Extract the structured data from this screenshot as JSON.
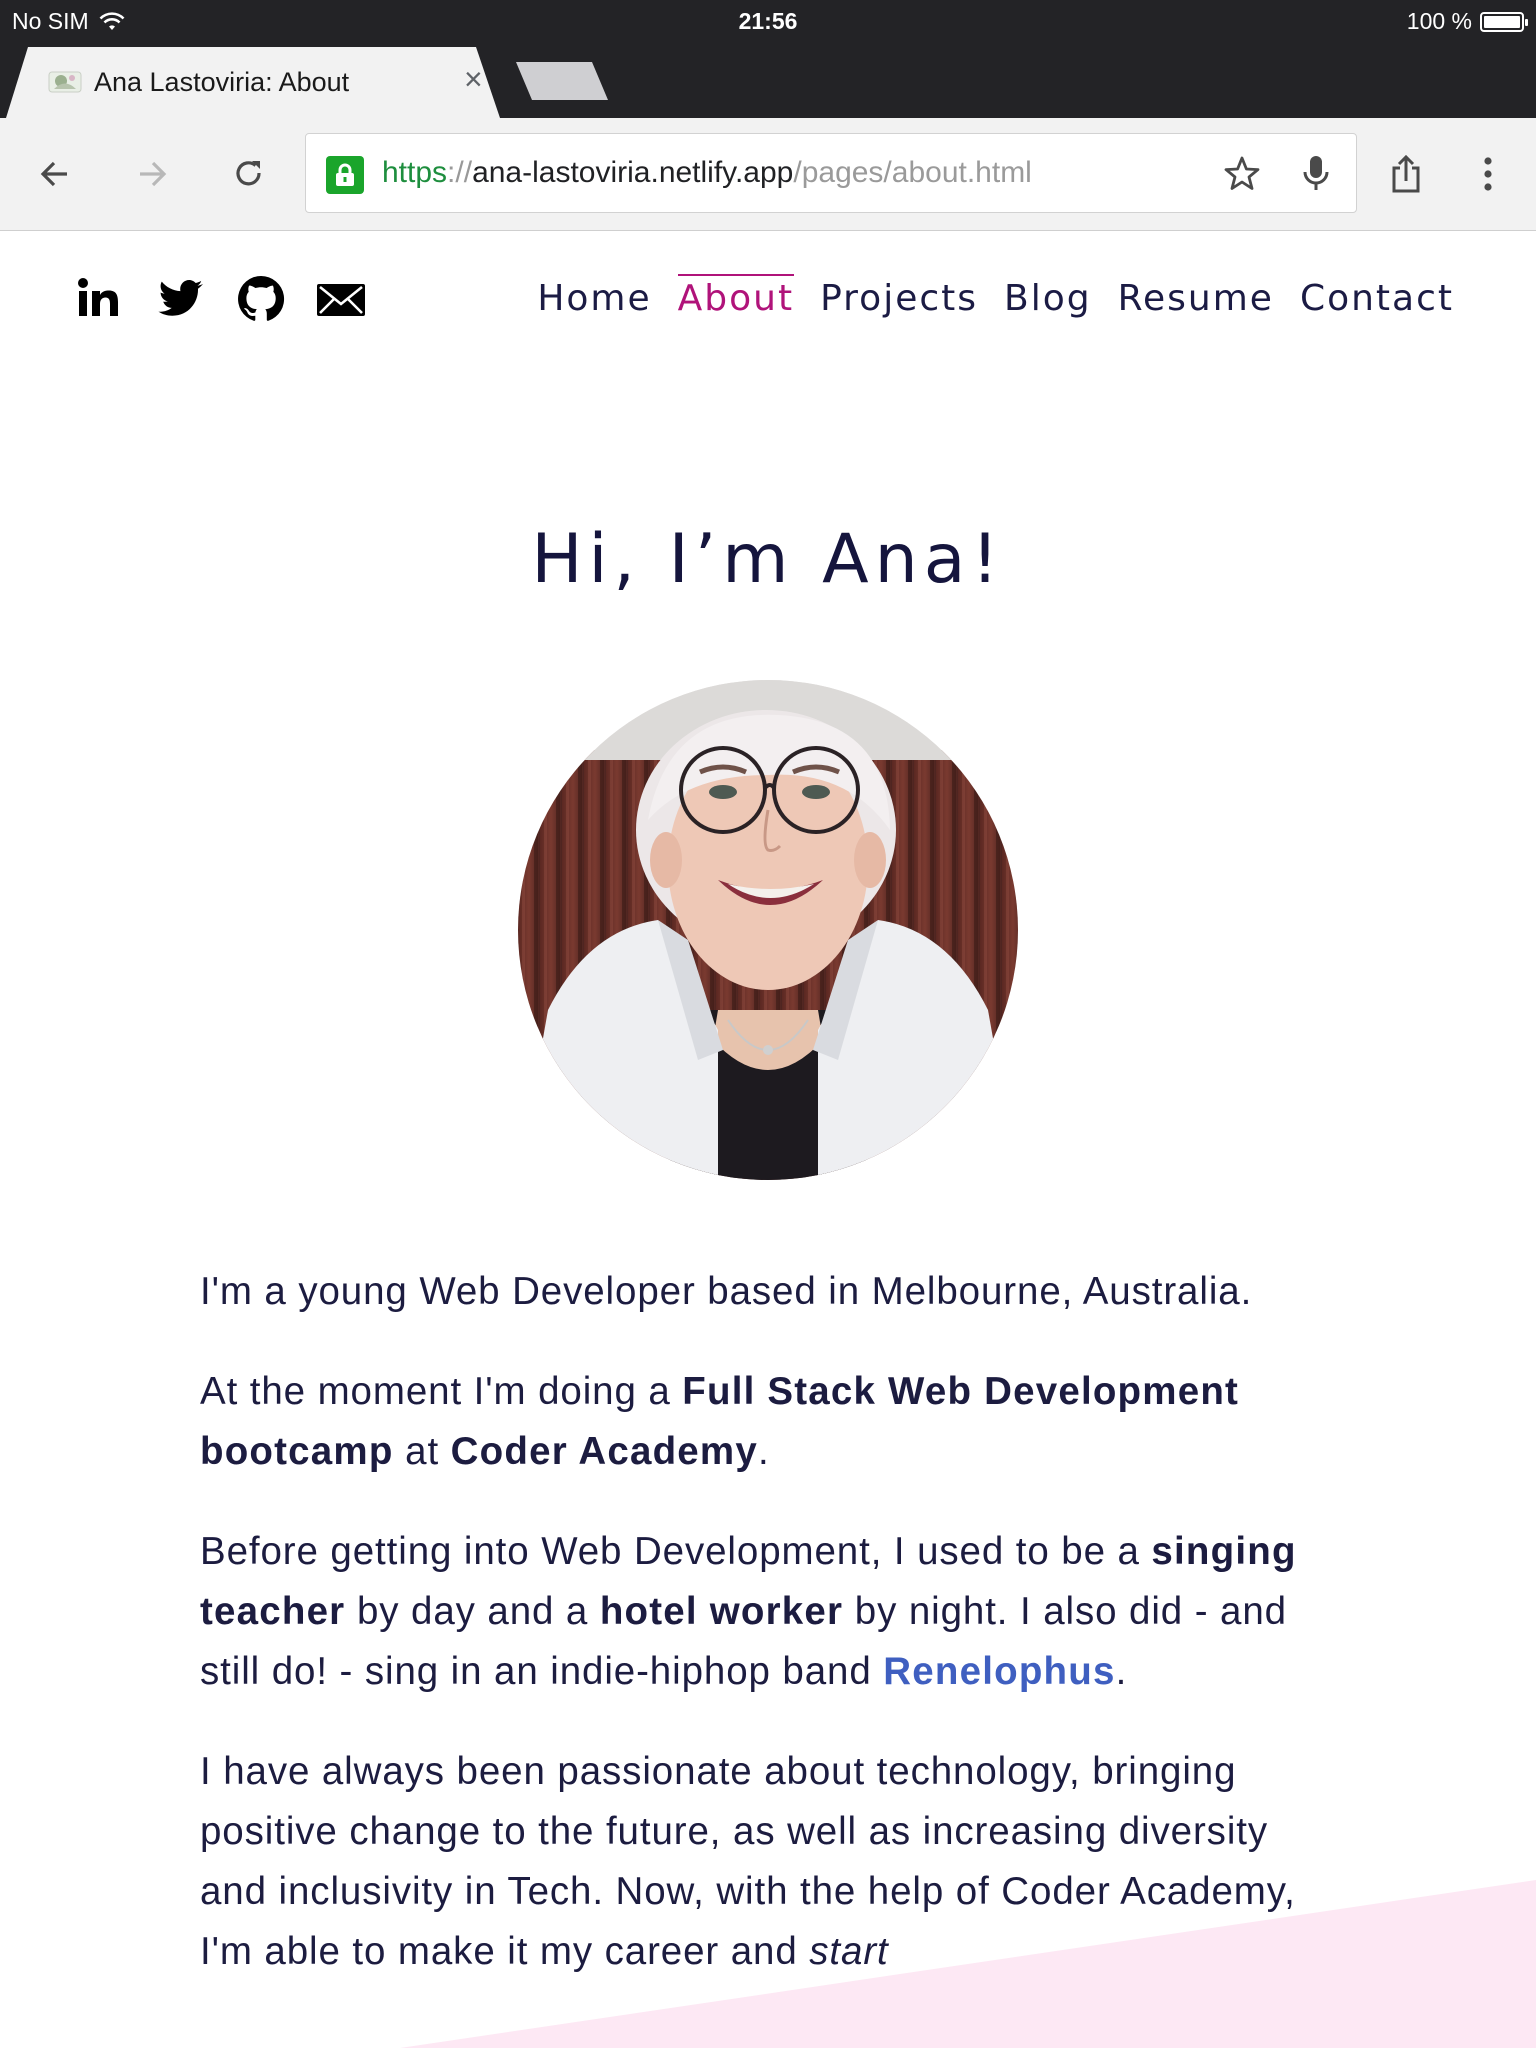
{
  "status_bar": {
    "carrier": "No SIM",
    "time": "21:56",
    "battery": "100 %",
    "battery_level": 1.0
  },
  "tab": {
    "title": "Ana Lastoviria: About"
  },
  "toolbar": {
    "url_scheme": "https",
    "url_sep": "://",
    "url_host": "ana-lastoviria.netlify.app",
    "url_path": "/pages/about.html"
  },
  "social": [
    "linkedin-icon",
    "twitter-icon",
    "github-icon",
    "email-icon"
  ],
  "nav": {
    "home": "Home",
    "about": "About",
    "projects": "Projects",
    "blog": "Blog",
    "resume": "Resume",
    "contact": "Contact",
    "active": "About"
  },
  "hero": {
    "title": "Hi, I’m Ana!"
  },
  "about": {
    "p1": "I'm a young Web Developer based in Melbourne, Australia.",
    "p2": {
      "t1": "At the moment I'm doing a ",
      "b1": "Full Stack Web Development bootcamp",
      "t2": " at ",
      "b2": "Coder Academy",
      "t3": "."
    },
    "p3": {
      "t1": "Before getting into Web Development, I used to be a ",
      "b1": "singing teacher",
      "t2": " by day and a ",
      "b2": "hotel worker",
      "t3": " by night. I also did - and still do! - sing in an indie-hiphop band ",
      "link": "Renelophus",
      "t4": "."
    },
    "p4": {
      "t1": "I have always been passionate about technology, bringing positive change to the future, as well as increasing diversity and inclusivity in Tech. Now, with the help of Coder Academy, I'm able to make it my career and ",
      "em": "start"
    }
  },
  "colors": {
    "nav_active": "#b0137a",
    "text": "#1c1c40",
    "link": "#3f5fc0",
    "lock": "#1aa52b",
    "chrome_dark": "#232326"
  }
}
